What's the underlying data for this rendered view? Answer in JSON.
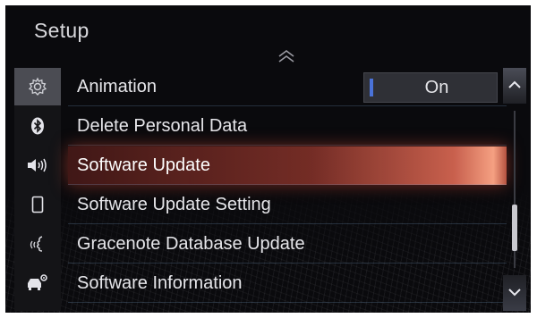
{
  "header": {
    "title": "Setup"
  },
  "sidebar": {
    "items": [
      {
        "icon": "gear-icon",
        "active": true
      },
      {
        "icon": "bluetooth-icon",
        "active": false
      },
      {
        "icon": "speaker-icon",
        "active": false
      },
      {
        "icon": "phone-icon",
        "active": false
      },
      {
        "icon": "voice-icon",
        "active": false
      },
      {
        "icon": "vehicle-settings-icon",
        "active": false
      }
    ]
  },
  "menu": {
    "items": [
      {
        "label": "Animation",
        "value": "On"
      },
      {
        "label": "Delete Personal Data"
      },
      {
        "label": "Software Update",
        "selected": true
      },
      {
        "label": "Software Update Setting"
      },
      {
        "label": "Gracenote Database Update"
      },
      {
        "label": "Software Information"
      }
    ]
  },
  "scroll": {
    "position": 0.85
  },
  "colors": {
    "accent": "#4a72d8",
    "highlight": "#d9644f",
    "background": "#0a0a0d"
  }
}
